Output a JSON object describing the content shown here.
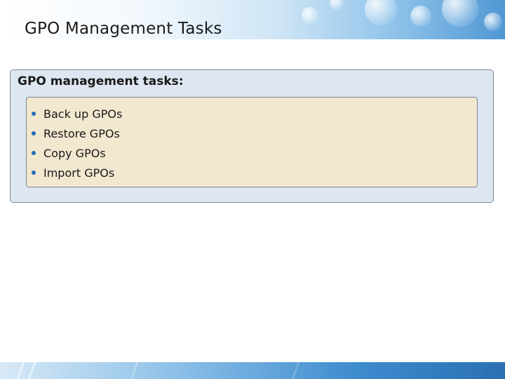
{
  "slide": {
    "title": "GPO Management Tasks"
  },
  "panel": {
    "heading": "GPO management tasks:",
    "items": [
      {
        "label": "Back up GPOs"
      },
      {
        "label": "Restore GPOs"
      },
      {
        "label": "Copy GPOs"
      },
      {
        "label": "Import GPOs"
      }
    ]
  },
  "colors": {
    "outer_panel_fill": "#dee6f1",
    "inner_panel_fill": "#f2e7cf",
    "bullet": "#1f6fb8",
    "header_accent": "#4f97d3"
  },
  "icons": {
    "bullet": "bullet-dot-icon"
  }
}
